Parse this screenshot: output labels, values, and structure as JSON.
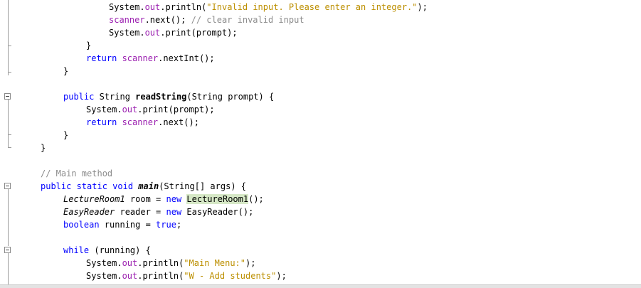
{
  "editor": {
    "lines": [
      {
        "indent": 153,
        "tokens": [
          {
            "t": "System."
          },
          {
            "t": "out",
            "c": "fld"
          },
          {
            "t": ".println("
          },
          {
            "t": "\"Invalid input. Please enter an integer.\"",
            "c": "str"
          },
          {
            "t": ");"
          }
        ]
      },
      {
        "indent": 153,
        "tokens": [
          {
            "t": "scanner",
            "c": "fld"
          },
          {
            "t": ".next(); "
          },
          {
            "t": "// clear invalid input",
            "c": "cmt"
          }
        ]
      },
      {
        "indent": 153,
        "tokens": [
          {
            "t": "System."
          },
          {
            "t": "out",
            "c": "fld"
          },
          {
            "t": ".print(prompt);"
          }
        ]
      },
      {
        "indent": 121,
        "tokens": [
          {
            "t": "}"
          }
        ]
      },
      {
        "indent": 121,
        "tokens": [
          {
            "t": "return ",
            "c": "kw"
          },
          {
            "t": "scanner",
            "c": "fld"
          },
          {
            "t": ".nextInt();"
          }
        ]
      },
      {
        "indent": 89,
        "tokens": [
          {
            "t": "}"
          }
        ]
      },
      {
        "indent": 89,
        "tokens": []
      },
      {
        "indent": 89,
        "tokens": [
          {
            "t": "public ",
            "c": "kw"
          },
          {
            "t": "String "
          },
          {
            "t": "readString",
            "c": "bold"
          },
          {
            "t": "(String prompt) {"
          }
        ]
      },
      {
        "indent": 121,
        "tokens": [
          {
            "t": "System."
          },
          {
            "t": "out",
            "c": "fld"
          },
          {
            "t": ".print(prompt);"
          }
        ]
      },
      {
        "indent": 121,
        "tokens": [
          {
            "t": "return ",
            "c": "kw"
          },
          {
            "t": "scanner",
            "c": "fld"
          },
          {
            "t": ".next();"
          }
        ]
      },
      {
        "indent": 89,
        "tokens": [
          {
            "t": "}"
          }
        ]
      },
      {
        "indent": 57,
        "tokens": [
          {
            "t": "}"
          }
        ]
      },
      {
        "indent": 57,
        "tokens": []
      },
      {
        "indent": 57,
        "tokens": [
          {
            "t": "// Main method",
            "c": "cmt"
          }
        ]
      },
      {
        "indent": 57,
        "tokens": [
          {
            "t": "public static void ",
            "c": "kw"
          },
          {
            "t": "main",
            "c": "bold ital"
          },
          {
            "t": "(String[] args) {"
          }
        ]
      },
      {
        "indent": 89,
        "tokens": [
          {
            "t": "LectureRoom1",
            "c": "ital"
          },
          {
            "t": " room = "
          },
          {
            "t": "new ",
            "c": "kw"
          },
          {
            "t": "LectureRoom1",
            "c": "hl"
          },
          {
            "t": "();"
          }
        ]
      },
      {
        "indent": 89,
        "tokens": [
          {
            "t": "EasyReader",
            "c": "ital"
          },
          {
            "t": " reader = "
          },
          {
            "t": "new ",
            "c": "kw"
          },
          {
            "t": "EasyReader();"
          }
        ]
      },
      {
        "indent": 89,
        "tokens": [
          {
            "t": "boolean ",
            "c": "kw"
          },
          {
            "t": "running = "
          },
          {
            "t": "true",
            "c": "kw"
          },
          {
            "t": ";"
          }
        ]
      },
      {
        "indent": 89,
        "tokens": []
      },
      {
        "indent": 89,
        "tokens": [
          {
            "t": "while ",
            "c": "kw"
          },
          {
            "t": "(running) {"
          }
        ]
      },
      {
        "indent": 121,
        "tokens": [
          {
            "t": "System."
          },
          {
            "t": "out",
            "c": "fld"
          },
          {
            "t": ".println("
          },
          {
            "t": "\"Main Menu:\"",
            "c": "str"
          },
          {
            "t": ");"
          }
        ]
      },
      {
        "indent": 121,
        "tokens": [
          {
            "t": "System."
          },
          {
            "t": "out",
            "c": "fld"
          },
          {
            "t": ".println("
          },
          {
            "t": "\"W - Add students\"",
            "c": "str"
          },
          {
            "t": ");"
          }
        ]
      }
    ]
  }
}
